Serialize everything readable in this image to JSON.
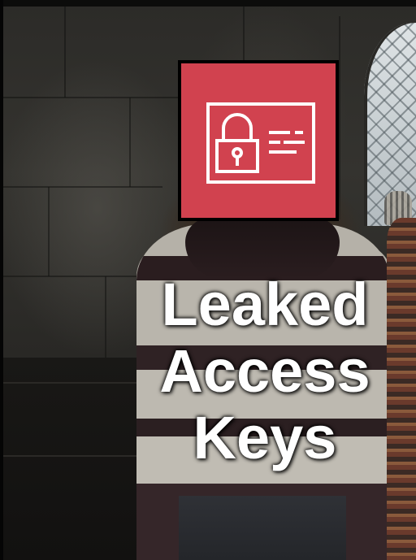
{
  "caption": {
    "lines": [
      "Leaked",
      "Access",
      "Keys"
    ]
  },
  "icon": {
    "name": "access-card-lock-icon",
    "background_color": "#d1424f",
    "stroke_color": "#ffffff"
  },
  "photo": {
    "subject": "person-photo"
  }
}
